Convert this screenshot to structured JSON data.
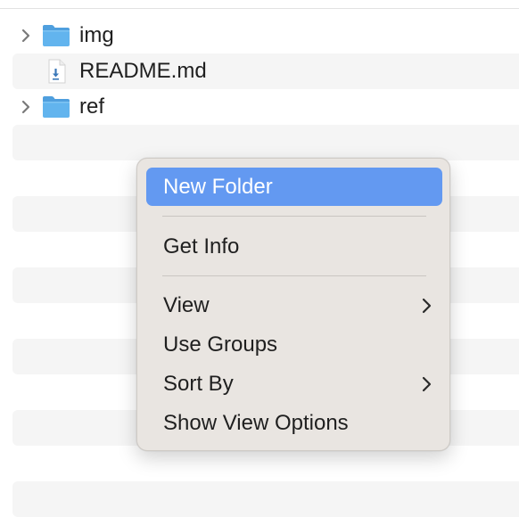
{
  "file_list": {
    "rows": [
      {
        "name": "img",
        "kind": "folder",
        "expandable": true,
        "icon": "folder-icon"
      },
      {
        "name": "README.md",
        "kind": "file",
        "expandable": false,
        "icon": "markdown-file-icon"
      },
      {
        "name": "ref",
        "kind": "folder",
        "expandable": true,
        "icon": "folder-icon"
      }
    ],
    "stripe_color": "#f5f5f5",
    "folder_color": "#5fb0ea"
  },
  "context_menu": {
    "items": [
      {
        "label": "New Folder",
        "highlighted": true,
        "has_submenu": false
      },
      {
        "label": "Get Info",
        "highlighted": false,
        "has_submenu": false
      },
      {
        "label": "View",
        "highlighted": false,
        "has_submenu": true
      },
      {
        "label": "Use Groups",
        "highlighted": false,
        "has_submenu": false
      },
      {
        "label": "Sort By",
        "highlighted": false,
        "has_submenu": true
      },
      {
        "label": "Show View Options",
        "highlighted": false,
        "has_submenu": false
      }
    ],
    "highlight_color": "#6399f1",
    "background_color": "#e9e5e1"
  }
}
